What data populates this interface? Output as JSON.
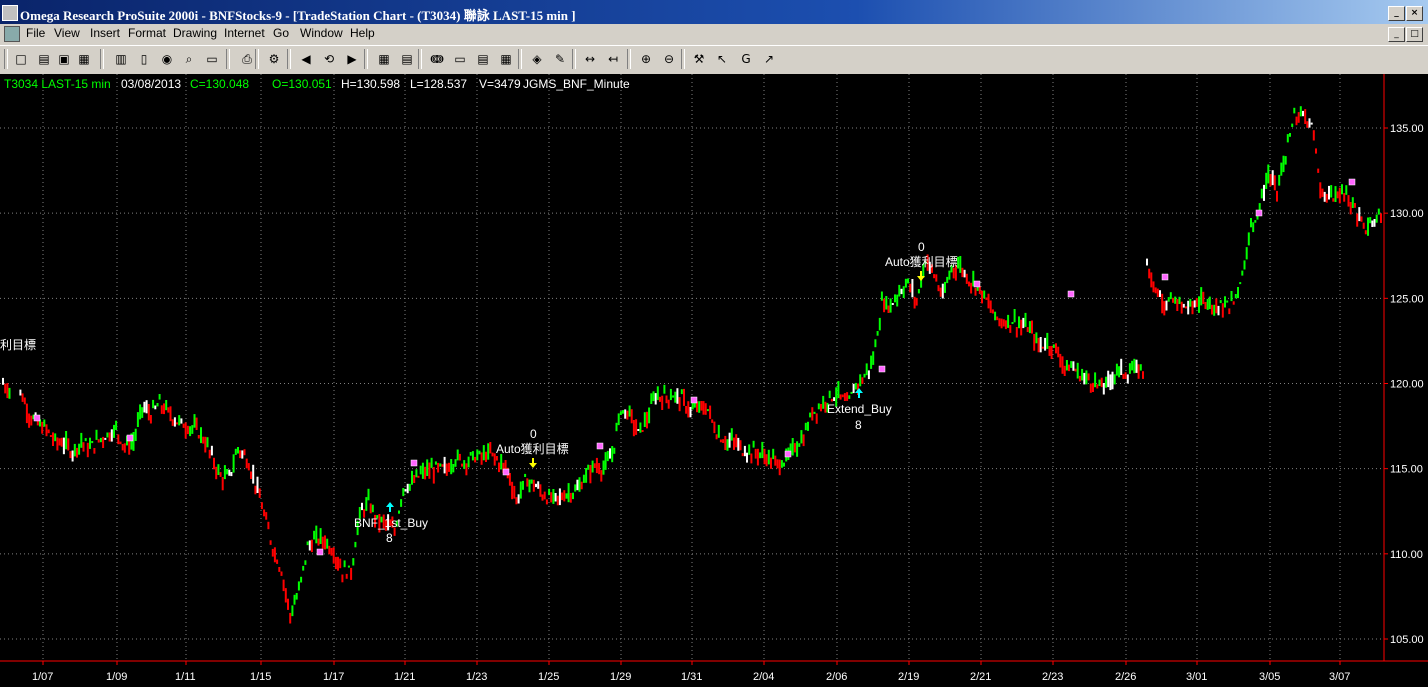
{
  "window": {
    "title": "Omega Research ProSuite 2000i - BNFStocks-9 - [TradeStation Chart - (T3034) 聯詠 LAST-15 min ]",
    "min_glyph": "_",
    "max_glyph": "□",
    "close_glyph": "×"
  },
  "menu": {
    "items": [
      "File",
      "View",
      "Insert",
      "Format",
      "Drawing",
      "Internet",
      "Go",
      "Window",
      "Help"
    ]
  },
  "toolbar": {
    "icons": [
      "new-doc-icon",
      "open-icon",
      "save-icon",
      "save-all-icon",
      "chart-icon",
      "bar-chart-icon",
      "refresh-icon",
      "search-icon",
      "page-icon",
      "print-icon",
      "properties-icon",
      "scroll-back-icon",
      "scroll-home-icon",
      "scroll-forward-icon",
      "insert-indicator-icon",
      "insert-strategy-icon",
      "analysis-icon",
      "window-icon",
      "grid-icon",
      "table-icon",
      "tracking-icon",
      "expert-icon",
      "compress-icon",
      "expand-icon",
      "zoom-in-icon",
      "zoom-out-icon",
      "tools-icon",
      "pointer-icon",
      "global-cursor-icon",
      "cursor-icon"
    ],
    "glyphs": [
      "□",
      "▤",
      "▣",
      "▦",
      "▥",
      "▯",
      "◉",
      "⌕",
      "▭",
      "⎙",
      "⚙",
      "◀",
      "⟲",
      "▶",
      "▦",
      "▤",
      "ↈ",
      "▭",
      "▤",
      "▦",
      "◈",
      "✎",
      "↔",
      "↤",
      "⊕",
      "⊖",
      "⚒",
      "↖",
      "G",
      "↗"
    ]
  },
  "chart_data": {
    "type": "bar",
    "symbol": "T3034",
    "interval": "LAST-15 min",
    "header": {
      "symbol_label": "T3034 LAST-15 min",
      "date": "03/08/2013",
      "close": "C=130.048",
      "open": "O=130.051",
      "high": "H=130.598",
      "low": "L=128.537",
      "volume": "V=3479",
      "strategy": "JGMS_BNF_Minute"
    },
    "y_ticks": [
      105.0,
      110.0,
      115.0,
      120.0,
      125.0,
      130.0,
      135.0
    ],
    "y_tick_labels": [
      "105.00",
      "110.00",
      "115.00",
      "120.00",
      "125.00",
      "130.00",
      "135.00"
    ],
    "ylim": [
      103.0,
      137.5
    ],
    "x_tick_labels": [
      "1/07",
      "1/09",
      "1/11",
      "1/15",
      "1/17",
      "1/21",
      "1/23",
      "1/25",
      "1/29",
      "1/31",
      "2/04",
      "2/06",
      "2/19",
      "2/21",
      "2/23",
      "2/26",
      "3/01",
      "3/05",
      "3/07"
    ],
    "grid": true,
    "bar_colors": {
      "up": "#00ff00",
      "down": "#ff0000",
      "flat": "#ffffff",
      "axis": "#ff0000",
      "grid": "#808080",
      "text_green": "#00ff00",
      "text_white": "#ffffff",
      "arrow_up": "#00ffff",
      "arrow_down": "#ffff00",
      "marker": "#ff66ff"
    },
    "close_path": [
      [
        0,
        120.0
      ],
      [
        2,
        119.5
      ],
      [
        3,
        118.2
      ],
      [
        4,
        117.6
      ],
      [
        5,
        117.3
      ],
      [
        6,
        116.6
      ],
      [
        7,
        116.5
      ],
      [
        8,
        116.0
      ],
      [
        9,
        116.6
      ],
      [
        10,
        116.2
      ],
      [
        11,
        116.7
      ],
      [
        12,
        117.0
      ],
      [
        13,
        117.3
      ],
      [
        14,
        116.3
      ],
      [
        15,
        116.6
      ],
      [
        16,
        118.6
      ],
      [
        17,
        118.2
      ],
      [
        18,
        118.8
      ],
      [
        19,
        118.3
      ],
      [
        20,
        117.8
      ],
      [
        21,
        117.5
      ],
      [
        22,
        117.4
      ],
      [
        23,
        116.8
      ],
      [
        24,
        115.7
      ],
      [
        25,
        114.5
      ],
      [
        26,
        114.5
      ],
      [
        27,
        116.2
      ],
      [
        28,
        115.6
      ],
      [
        29,
        114.2
      ],
      [
        30,
        112.3
      ],
      [
        31,
        110.4
      ],
      [
        32,
        109.0
      ],
      [
        33,
        106.4
      ],
      [
        34,
        107.8
      ],
      [
        35,
        110.4
      ],
      [
        36,
        110.9
      ],
      [
        37,
        110.8
      ],
      [
        38,
        110.1
      ],
      [
        39,
        109.0
      ],
      [
        40,
        109.0
      ],
      [
        41,
        112.3
      ],
      [
        42,
        113.0
      ],
      [
        43,
        112.0
      ],
      [
        44,
        111.8
      ],
      [
        45,
        111.3
      ],
      [
        46,
        113.9
      ],
      [
        47,
        114.1
      ],
      [
        48,
        114.7
      ],
      [
        49,
        114.9
      ],
      [
        50,
        115.0
      ],
      [
        51,
        115.0
      ],
      [
        52,
        115.6
      ],
      [
        53,
        115.4
      ],
      [
        54,
        115.7
      ],
      [
        55,
        115.7
      ],
      [
        56,
        115.9
      ],
      [
        57,
        115.4
      ],
      [
        58,
        114.9
      ],
      [
        59,
        113.1
      ],
      [
        60,
        114.3
      ],
      [
        61,
        114.1
      ],
      [
        62,
        113.5
      ],
      [
        63,
        113.2
      ],
      [
        64,
        113.3
      ],
      [
        65,
        113.6
      ],
      [
        66,
        113.7
      ],
      [
        67,
        114.6
      ],
      [
        68,
        115.2
      ],
      [
        69,
        115.0
      ],
      [
        70,
        115.8
      ],
      [
        71,
        118.5
      ],
      [
        72,
        118.2
      ],
      [
        73,
        117.1
      ],
      [
        74,
        117.9
      ],
      [
        75,
        119.3
      ],
      [
        76,
        119.2
      ],
      [
        77,
        119.3
      ],
      [
        78,
        119.1
      ],
      [
        79,
        118.4
      ],
      [
        80,
        118.6
      ],
      [
        81,
        118.5
      ],
      [
        82,
        117.1
      ],
      [
        83,
        116.6
      ],
      [
        84,
        116.6
      ],
      [
        85,
        116.1
      ],
      [
        86,
        116.0
      ],
      [
        87,
        115.9
      ],
      [
        88,
        115.6
      ],
      [
        89,
        115.3
      ],
      [
        90,
        115.5
      ],
      [
        91,
        116.3
      ],
      [
        92,
        116.8
      ],
      [
        93,
        118.3
      ],
      [
        94,
        118.7
      ],
      [
        95,
        119.2
      ],
      [
        96,
        119.4
      ],
      [
        97,
        118.7
      ],
      [
        98,
        119.9
      ],
      [
        99,
        120.4
      ],
      [
        100,
        121.4
      ],
      [
        101,
        124.7
      ],
      [
        102,
        124.6
      ],
      [
        103,
        125.4
      ],
      [
        104,
        125.9
      ],
      [
        105,
        124.8
      ],
      [
        106,
        127.3
      ],
      [
        107,
        126.4
      ],
      [
        108,
        125.0
      ],
      [
        109,
        126.8
      ],
      [
        110,
        126.9
      ],
      [
        111,
        126.1
      ],
      [
        112,
        125.7
      ],
      [
        113,
        124.9
      ],
      [
        114,
        123.9
      ],
      [
        115,
        123.6
      ],
      [
        116,
        123.7
      ],
      [
        117,
        123.4
      ],
      [
        118,
        123.2
      ],
      [
        119,
        122.2
      ],
      [
        120,
        122.4
      ],
      [
        121,
        122.0
      ],
      [
        122,
        121.0
      ],
      [
        123,
        120.9
      ],
      [
        124,
        120.4
      ],
      [
        125,
        120.2
      ],
      [
        126,
        119.8
      ],
      [
        127,
        120.0
      ],
      [
        128,
        120.8
      ],
      [
        129,
        120.6
      ],
      [
        130,
        120.8
      ],
      [
        131,
        120.8
      ]
    ],
    "close_path_b": [
      [
        0,
        127.0
      ],
      [
        1,
        125.5
      ],
      [
        2,
        124.8
      ],
      [
        3,
        124.8
      ],
      [
        4,
        124.5
      ],
      [
        5,
        124.5
      ],
      [
        6,
        124.8
      ],
      [
        7,
        124.9
      ],
      [
        8,
        124.5
      ],
      [
        9,
        124.5
      ],
      [
        10,
        124.8
      ],
      [
        11,
        126.5
      ],
      [
        12,
        129.2
      ],
      [
        13,
        130.4
      ],
      [
        14,
        132.3
      ],
      [
        15,
        131.3
      ],
      [
        16,
        133.4
      ],
      [
        17,
        135.6
      ],
      [
        18,
        135.7
      ],
      [
        19,
        135.4
      ],
      [
        20,
        131.6
      ],
      [
        21,
        130.8
      ],
      [
        22,
        131.2
      ],
      [
        23,
        131.0
      ],
      [
        24,
        130.3
      ],
      [
        25,
        129.0
      ],
      [
        26,
        129.5
      ],
      [
        27,
        130.0
      ]
    ],
    "annotations": [
      {
        "text": "利目標",
        "x_label": "edge"
      },
      {
        "text": "0",
        "x_label": "1/25"
      },
      {
        "text": "Auto獲利目標",
        "x_label": "1/25"
      },
      {
        "text": "BNF_1st_Buy",
        "x_label": "1/21"
      },
      {
        "text": "8",
        "x_label": "1/21"
      },
      {
        "text": "Extend_Buy",
        "x_label": "2/06"
      },
      {
        "text": "8",
        "x_label": "2/06"
      },
      {
        "text": "0",
        "x_label": "2/19"
      },
      {
        "text": "Auto獲利目標",
        "x_label": "2/19"
      }
    ]
  }
}
